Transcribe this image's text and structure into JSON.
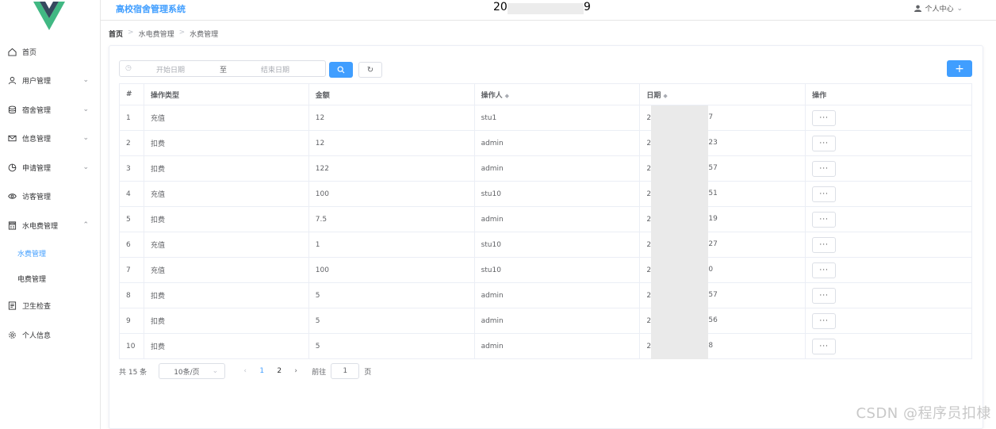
{
  "app": {
    "title": "高校宿舍管理系统",
    "center_text": "20",
    "center_text_tail": "9",
    "user_menu": "个人中心"
  },
  "sidebar": {
    "items": [
      {
        "label": "首页",
        "icon": "home-icon",
        "chevron": ""
      },
      {
        "label": "用户管理",
        "icon": "user-icon",
        "chevron": "⌄"
      },
      {
        "label": "宿舍管理",
        "icon": "database-icon",
        "chevron": "⌄"
      },
      {
        "label": "信息管理",
        "icon": "message-icon",
        "chevron": "⌄"
      },
      {
        "label": "申请管理",
        "icon": "pie-chart-icon",
        "chevron": "⌄"
      },
      {
        "label": "访客管理",
        "icon": "eye-icon",
        "chevron": ""
      },
      {
        "label": "水电费管理",
        "icon": "calculator-icon",
        "chevron": "⌃"
      }
    ],
    "sub_items": [
      {
        "label": "水费管理",
        "active": true
      },
      {
        "label": "电费管理",
        "active": false
      }
    ],
    "bottom_items": [
      {
        "label": "卫生检查",
        "icon": "document-icon"
      },
      {
        "label": "个人信息",
        "icon": "gear-icon"
      }
    ]
  },
  "breadcrumb": [
    "首页",
    "水电费管理",
    "水费管理"
  ],
  "toolbar": {
    "start_placeholder": "开始日期",
    "range_sep": "至",
    "end_placeholder": "结束日期",
    "add_label": "+"
  },
  "table": {
    "headers": [
      "#",
      "操作类型",
      "金额",
      "操作人",
      "日期",
      "操作"
    ],
    "rows": [
      {
        "no": "1",
        "type": "充值",
        "amount": "12",
        "operator": "stu1",
        "date_head": "2",
        "date_tail": "7"
      },
      {
        "no": "2",
        "type": "扣费",
        "amount": "12",
        "operator": "admin",
        "date_head": "2",
        "date_tail": "23"
      },
      {
        "no": "3",
        "type": "扣费",
        "amount": "122",
        "operator": "admin",
        "date_head": "2",
        "date_tail": "57"
      },
      {
        "no": "4",
        "type": "充值",
        "amount": "100",
        "operator": "stu10",
        "date_head": "2",
        "date_tail": "51"
      },
      {
        "no": "5",
        "type": "扣费",
        "amount": "7.5",
        "operator": "admin",
        "date_head": "2",
        "date_tail": "19"
      },
      {
        "no": "6",
        "type": "充值",
        "amount": "1",
        "operator": "stu10",
        "date_head": "2",
        "date_tail": "27"
      },
      {
        "no": "7",
        "type": "充值",
        "amount": "100",
        "operator": "stu10",
        "date_head": "2",
        "date_tail": "0"
      },
      {
        "no": "8",
        "type": "扣费",
        "amount": "5",
        "operator": "admin",
        "date_head": "2",
        "date_tail": "57"
      },
      {
        "no": "9",
        "type": "扣费",
        "amount": "5",
        "operator": "admin",
        "date_head": "2",
        "date_tail": "56"
      },
      {
        "no": "10",
        "type": "扣费",
        "amount": "5",
        "operator": "admin",
        "date_head": "2",
        "date_tail": "8"
      }
    ],
    "op_label": "···"
  },
  "pager": {
    "total": "共 15 条",
    "page_size": "10条/页",
    "pages": [
      "1",
      "2"
    ],
    "current": "1",
    "goto_prefix": "前往",
    "goto_value": "1",
    "goto_suffix": "页"
  },
  "watermark": "CSDN @程序员扣棣",
  "colors": {
    "primary": "#409eff",
    "border": "#ebeef5"
  }
}
